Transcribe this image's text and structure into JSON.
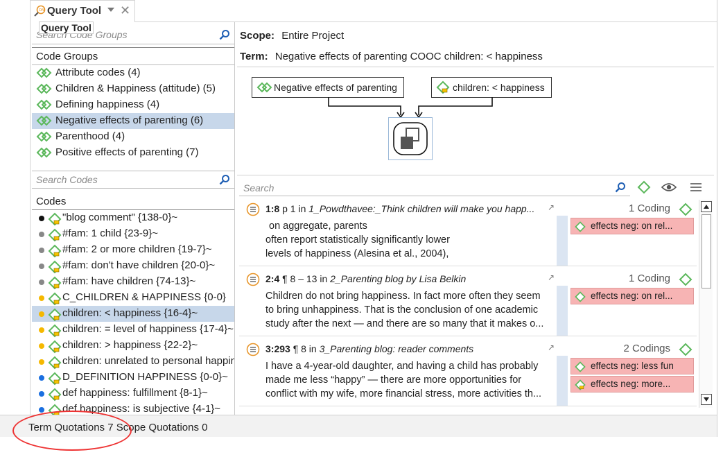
{
  "tab": {
    "title": "Query Tool",
    "tooltip": "Query Tool"
  },
  "left": {
    "code_groups_search_placeholder": "Search Code Groups",
    "code_groups_header": "Code Groups",
    "code_groups": [
      {
        "label": "Attribute codes (4)"
      },
      {
        "label": "Children & Happiness (attitude) (5)"
      },
      {
        "label": "Defining happiness (4)"
      },
      {
        "label": "Negative effects of parenting (6)",
        "selected": true
      },
      {
        "label": "Parenthood (4)"
      },
      {
        "label": "Positive effects of parenting (7)"
      }
    ],
    "codes_search_placeholder": "Search Codes",
    "codes_header": "Codes",
    "codes": [
      {
        "label": "\"blog comment\" {138-0}~",
        "dot": "#111111"
      },
      {
        "label": "#fam: 1 child {23-9}~",
        "dot": "#888888"
      },
      {
        "label": "#fam: 2 or more  children {19-7}~",
        "dot": "#888888"
      },
      {
        "label": "#fam: don't have children {20-0}~",
        "dot": "#888888"
      },
      {
        "label": "#fam: have children {74-13}~",
        "dot": "#888888"
      },
      {
        "label": "C_CHILDREN & HAPPINESS {0-0}",
        "dot": "#f5b800"
      },
      {
        "label": "children: < happiness {16-4}~",
        "dot": "#f5b800",
        "selected": true
      },
      {
        "label": "children: = level of happiness {17-4}~",
        "dot": "#f5b800"
      },
      {
        "label": "children: > happiness {22-2}~",
        "dot": "#f5b800"
      },
      {
        "label": "children: unrelated to personal happiness",
        "dot": "#f5b800"
      },
      {
        "label": "D_DEFINITION HAPPINESS {0-0}~",
        "dot": "#1a6fe0"
      },
      {
        "label": "def happiness: fulfillment {8-1}~",
        "dot": "#1a6fe0"
      },
      {
        "label": "def happiness: is subjective {4-1}~",
        "dot": "#1a6fe0"
      }
    ]
  },
  "right": {
    "scope_label": "Scope:",
    "scope_value": "Entire Project",
    "term_label": "Term:",
    "term_value": "Negative effects of parenting COOC children: < happiness",
    "diagram": {
      "left_node": "Negative effects of parenting",
      "right_node": "children: < happiness"
    },
    "search_placeholder": "Search",
    "quotations": [
      {
        "ref": "1:8",
        "loc": "p 1 in",
        "title": "1_Powdthavee:_Think children will make you happ...",
        "count": "1 Coding",
        "lines": [
          "on aggregate, parents",
          "often report statistically significantly lower",
          "levels of happiness (Alesina et al., 2004),"
        ],
        "tags": [
          "effects neg: on rel..."
        ]
      },
      {
        "ref": "2:4",
        "loc": "¶ 8 – 13 in",
        "title": "2_Parenting blog by Lisa Belkin",
        "count": "1 Coding",
        "lines": [
          "Children do not bring happiness. In fact more often they seem",
          "to bring unhappiness. That is the conclusion of one academic",
          "study after the next — and there are so many that it makes o..."
        ],
        "tags": [
          "effects neg: on rel..."
        ]
      },
      {
        "ref": "3:293",
        "loc": "¶ 8 in",
        "title": "3_Parenting blog: reader comments",
        "count": "2 Codings",
        "lines": [
          "I have a 4-year-old daughter, and having a child has probably",
          "made me less “happy” — there are more opportunities for",
          "conflict with my wife, more financial stress, more activities th..."
        ],
        "tags": [
          "effects neg: less fun",
          "effects neg: more..."
        ]
      }
    ]
  },
  "footer": {
    "text": "Term Quotations 7  Scope Quotations 0"
  },
  "colors": {
    "selection": "#c7d7ea",
    "code_green": "#5cb85c",
    "tag_bg": "#f7b4b4",
    "annotation_circle": "#e33333"
  }
}
